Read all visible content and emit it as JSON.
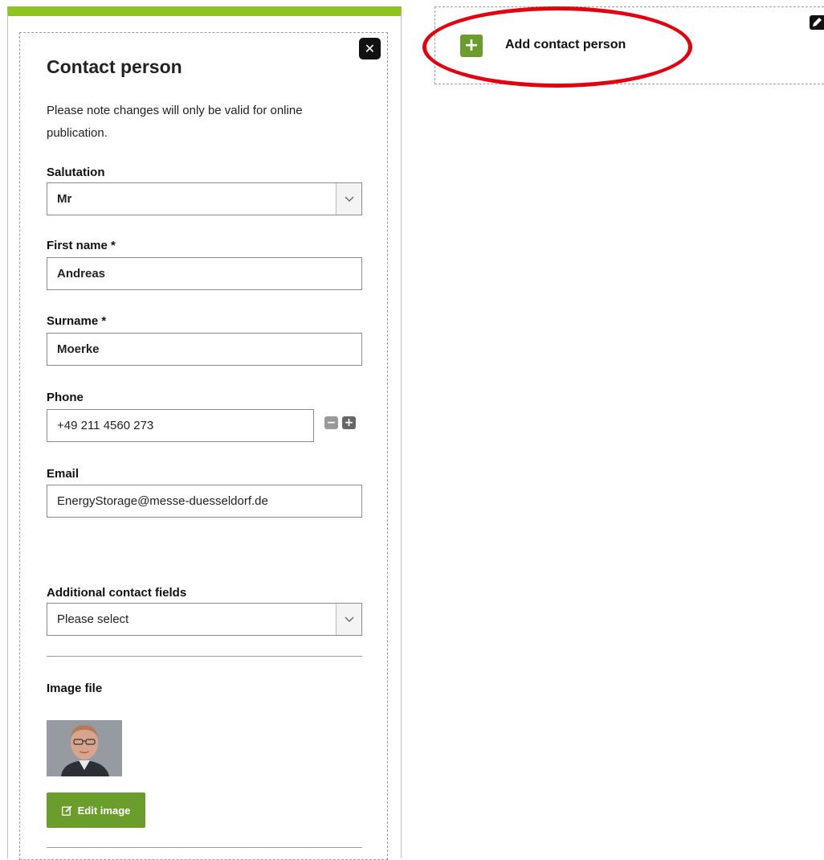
{
  "form": {
    "title": "Contact person",
    "note": "Please note changes will only be valid for online publication.",
    "close_icon": "close-icon",
    "salutation": {
      "label": "Salutation",
      "value": "Mr"
    },
    "first_name": {
      "label": "First name *",
      "value": "Andreas"
    },
    "surname": {
      "label": "Surname *",
      "value": "Moerke"
    },
    "phone": {
      "label": "Phone",
      "value": "+49 211 4560 273",
      "remove_symbol": "−",
      "add_symbol": "+"
    },
    "email": {
      "label": "Email",
      "value": "EnergyStorage@messe-duesseldorf.de"
    },
    "additional_fields": {
      "label": "Additional contact fields",
      "value": "Please select"
    },
    "image": {
      "label": "Image file",
      "edit_label": "Edit image"
    }
  },
  "add_panel": {
    "add_label": "Add contact person",
    "add_symbol": "+",
    "edit_icon": "pencil-icon"
  },
  "colors": {
    "accent_green": "#6a9d2b",
    "top_bar_green": "#8fc31f",
    "highlight_red": "#e3000f"
  }
}
